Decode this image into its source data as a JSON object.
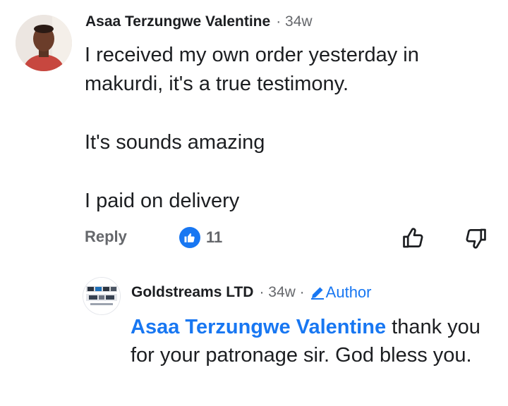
{
  "comment": {
    "author": "Asaa Terzungwe Valentine",
    "time": "· 34w",
    "paragraphs": [
      "I received my own order yesterday in makurdi, it's a true testimony.",
      "It's sounds amazing",
      "I paid on delivery"
    ],
    "reply_label": "Reply",
    "reaction_icon": "like-icon",
    "reaction_count": "11",
    "like_action_icon": "thumbs-up-icon",
    "dislike_action_icon": "thumbs-down-icon"
  },
  "reply": {
    "author": "Goldstreams LTD",
    "time": "· 34w ·",
    "badge_icon": "pencil-icon",
    "badge_label": "Author",
    "mention": "Asaa Terzungwe Valentine",
    "text": " thank you for your patronage sir. God bless you."
  },
  "colors": {
    "accent": "#1877f2",
    "text": "#1c1e21",
    "muted": "#65676b"
  }
}
